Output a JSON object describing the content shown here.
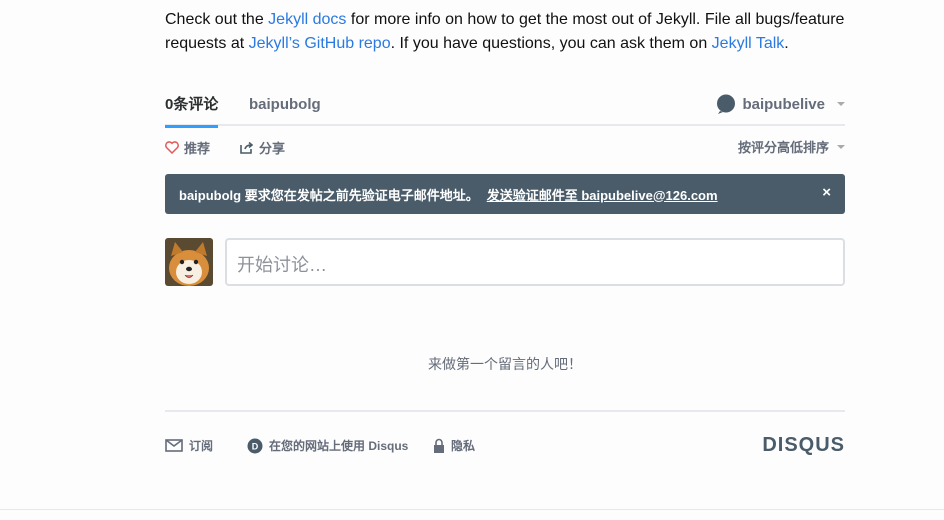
{
  "intro": {
    "t1": "Check out the ",
    "docs_link": "Jekyll docs",
    "t2": " for more info on how to get the most out of Jekyll. File all bugs/feature requests at ",
    "github_link": "Jekyll’s GitHub repo",
    "t3": ". If you have questions, you can ask them on ",
    "talk_link": "Jekyll Talk",
    "t4": "."
  },
  "tabs": {
    "comments": "0条评论",
    "community": "baipubolg",
    "user": "baipubelive"
  },
  "actions": {
    "recommend": "推荐",
    "share": "分享",
    "sort": "按评分高低排序"
  },
  "alert": {
    "message": "baipubolg 要求您在发帖之前先验证电子邮件地址。",
    "link": "发送验证邮件至 baipubelive@126.com",
    "close": "×"
  },
  "compose": {
    "placeholder": "开始讨论…"
  },
  "empty_text": "来做第一个留言的人吧！",
  "footer": {
    "subscribe": "订阅",
    "add_disqus": "在您的网站上使用 Disqus",
    "privacy": "隐私",
    "brand": "DISQUS"
  },
  "colors": {
    "link": "#2a7ae2",
    "active_tab": "#2e9fff",
    "alert_bg": "#4a5c6a",
    "text_muted": "#656c7a"
  }
}
